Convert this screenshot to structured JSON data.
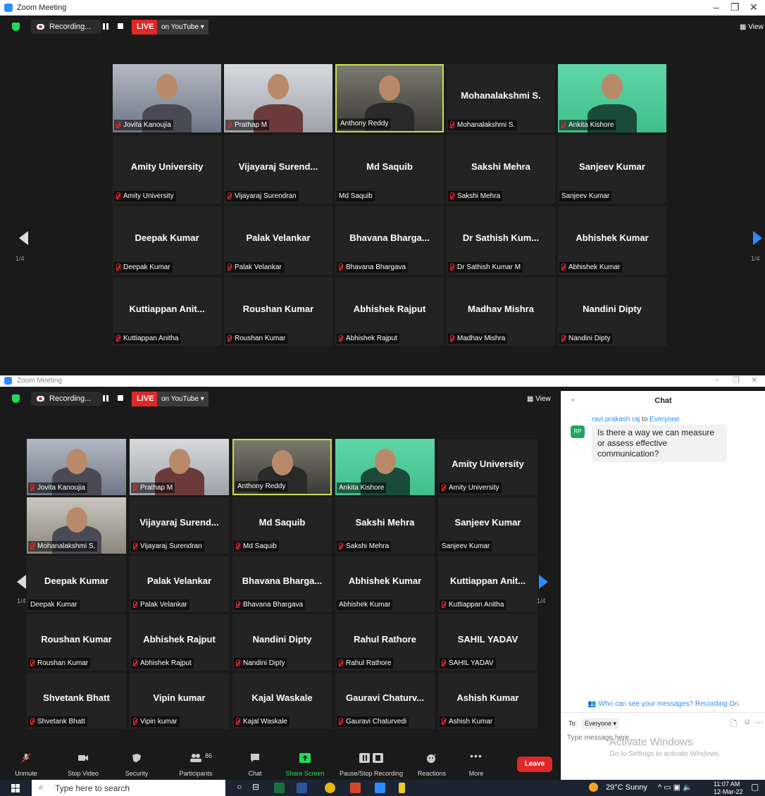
{
  "top": {
    "title": "Zoom Meeting",
    "recording": "Recording...",
    "live": "LIVE",
    "youtube": "on YouTube ▾",
    "view": "View",
    "page": "1/4",
    "tiles": [
      {
        "name": "Jovita Kanoujia",
        "photo": true,
        "muted": true
      },
      {
        "name": "Prathap M",
        "photo": true,
        "muted": true
      },
      {
        "name": "Anthony Reddy",
        "photo": true,
        "muted": false,
        "active": true
      },
      {
        "name": "Mohanalakshmi S.",
        "big": "Mohanalakshmi S.",
        "muted": true
      },
      {
        "name": "Ankita Kishore",
        "photo": true,
        "muted": true
      },
      {
        "name": "Amity University",
        "big": "Amity University",
        "muted": true
      },
      {
        "name": "Vijayaraj Surendran",
        "big": "Vijayaraj  Surend...",
        "muted": true
      },
      {
        "name": "Md Saquib",
        "big": "Md Saquib",
        "muted": false
      },
      {
        "name": "Sakshi Mehra",
        "big": "Sakshi Mehra",
        "muted": true
      },
      {
        "name": "Sanjeev Kumar",
        "big": "Sanjeev Kumar",
        "muted": false
      },
      {
        "name": "Deepak Kumar",
        "big": "Deepak Kumar",
        "muted": true
      },
      {
        "name": "Palak Velankar",
        "big": "Palak Velankar",
        "muted": true
      },
      {
        "name": "Bhavana Bhargava",
        "big": "Bhavana  Bharga...",
        "muted": true
      },
      {
        "name": "Dr Sathish Kumar M",
        "big": "Dr Sathish  Kum...",
        "muted": true
      },
      {
        "name": "Abhishek Kumar",
        "big": "Abhishek Kumar",
        "muted": true
      },
      {
        "name": "Kuttiappan Anitha",
        "big": "Kuttiappan  Anit...",
        "muted": true
      },
      {
        "name": "Roushan Kumar",
        "big": "Roushan Kumar",
        "muted": true
      },
      {
        "name": "Abhishek Rajput",
        "big": "Abhishek Rajput",
        "muted": true
      },
      {
        "name": "Madhav Mishra",
        "big": "Madhav Mishra",
        "muted": true
      },
      {
        "name": "Nandini Dipty",
        "big": "Nandini Dipty",
        "muted": true
      }
    ]
  },
  "bottom": {
    "title": "Zoom Meeting",
    "recording": "Recording...",
    "live": "LIVE",
    "youtube": "on YouTube ▾",
    "view": "View",
    "page": "1/4",
    "tiles": [
      {
        "name": "Jovita Kanoujia",
        "photo": true,
        "muted": true
      },
      {
        "name": "Prathap M",
        "photo": true,
        "muted": true
      },
      {
        "name": "Anthony Reddy",
        "photo": true,
        "muted": false,
        "active": true
      },
      {
        "name": "Ankita Kishore",
        "photo": true,
        "muted": false
      },
      {
        "name": "Amity University",
        "big": "Amity University",
        "muted": true
      },
      {
        "name": "Mohanalakshmi S.",
        "photo": true,
        "muted": true
      },
      {
        "name": "Vijayaraj Surendran",
        "big": "Vijayaraj  Surend...",
        "muted": true
      },
      {
        "name": "Md Saquib",
        "big": "Md Saquib",
        "muted": true
      },
      {
        "name": "Sakshi Mehra",
        "big": "Sakshi Mehra",
        "muted": true
      },
      {
        "name": "Sanjeev Kumar",
        "big": "Sanjeev Kumar",
        "muted": false
      },
      {
        "name": "Deepak Kumar",
        "big": "Deepak Kumar",
        "muted": false
      },
      {
        "name": "Palak Velankar",
        "big": "Palak Velankar",
        "muted": true
      },
      {
        "name": "Bhavana Bhargava",
        "big": "Bhavana  Bharga...",
        "muted": true
      },
      {
        "name": "Abhishek Kumar",
        "big": "Abhishek Kumar",
        "muted": false
      },
      {
        "name": "Kuttiappan Anitha",
        "big": "Kuttiappan  Anit...",
        "muted": true
      },
      {
        "name": "Roushan Kumar",
        "big": "Roushan Kumar",
        "muted": true
      },
      {
        "name": "Abhishek Rajput",
        "big": "Abhishek Rajput",
        "muted": true
      },
      {
        "name": "Nandini Dipty",
        "big": "Nandini Dipty",
        "muted": true
      },
      {
        "name": "Rahul Rathore",
        "big": "Rahul Rathore",
        "muted": true
      },
      {
        "name": "SAHIL YADAV",
        "big": "SAHIL YADAV",
        "muted": true
      },
      {
        "name": "Shvetank Bhatt",
        "big": "Shvetank Bhatt",
        "muted": true
      },
      {
        "name": "Vipin kumar",
        "big": "Vipin kumar",
        "muted": true
      },
      {
        "name": "Kajal Waskale",
        "big": "Kajal Waskale",
        "muted": true
      },
      {
        "name": "Gauravi Chaturvedi",
        "big": "Gauravi  Chaturv...",
        "muted": true
      },
      {
        "name": "Ashish Kumar",
        "big": "Ashish Kumar",
        "muted": true
      }
    ],
    "toolbar": {
      "unmute": "Unmute",
      "stop_video": "Stop Video",
      "security": "Security",
      "participants": "Participants",
      "participants_count": "86",
      "chat": "Chat",
      "share_screen": "Share Screen",
      "pause_stop_recording": "Pause/Stop Recording",
      "reactions": "Reactions",
      "more": "More",
      "leave": "Leave"
    }
  },
  "chat": {
    "title": "Chat",
    "sender": "ravi prakash raj",
    "to_word": "to",
    "recipient": "Everyone",
    "avatar": "RP",
    "message": "Is there a way we can measure or assess effective communication?",
    "notice": "Who can see your messages? Recording On",
    "to_label": "To:",
    "to_value": "Everyone ▾",
    "placeholder": "Type message here...",
    "watermark1": "Activate Windows",
    "watermark2": "Go to Settings to activate Windows."
  },
  "taskbar": {
    "search": "Type here to search",
    "weather": "29°C  Sunny",
    "time": "11:07 AM",
    "date": "12-Mar-22"
  },
  "colors": {
    "zoom_blue": "#2D8CFF",
    "live_red": "#E02828",
    "leave_red": "#E02828",
    "active_border": "#c8e04f",
    "share_green": "#23D959"
  }
}
